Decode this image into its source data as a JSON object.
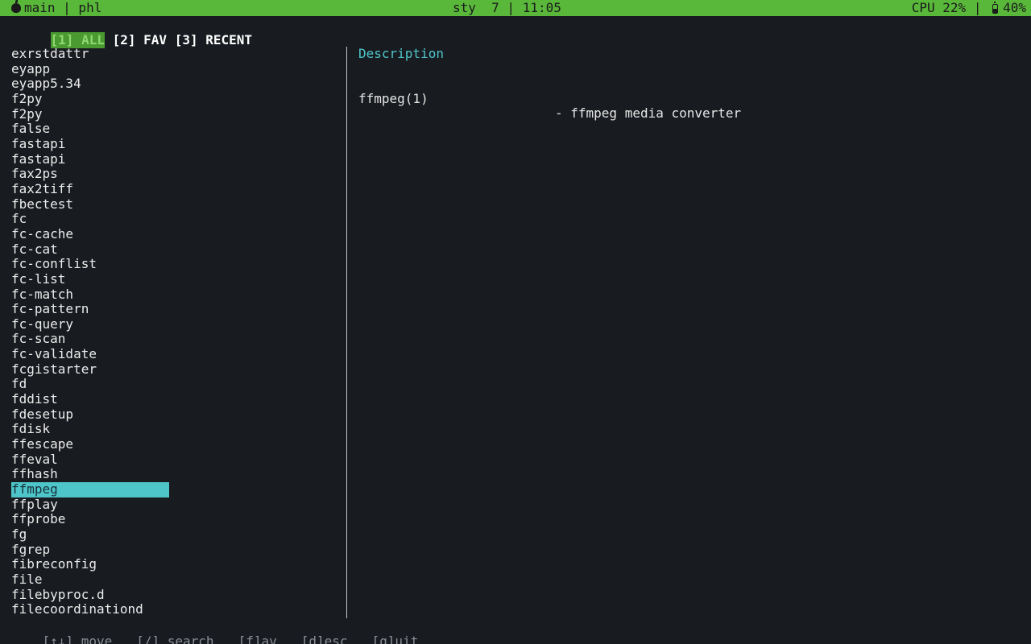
{
  "statusbar": {
    "left_text": "main | phl",
    "center_text": "sty  7 | 11:05",
    "cpu_text": "CPU 22% |",
    "battery_text": "40%",
    "bg_color": "#59b73a"
  },
  "tabs": [
    {
      "label": "[1] ALL",
      "active": true
    },
    {
      "label": "[2] FAV",
      "active": false
    },
    {
      "label": "[3] RECENT",
      "active": false
    }
  ],
  "commands": [
    "exrstdattr",
    "eyapp",
    "eyapp5.34",
    "f2py",
    "f2py",
    "false",
    "fastapi",
    "fastapi",
    "fax2ps",
    "fax2tiff",
    "fbectest",
    "fc",
    "fc-cache",
    "fc-cat",
    "fc-conflist",
    "fc-list",
    "fc-match",
    "fc-pattern",
    "fc-query",
    "fc-scan",
    "fc-validate",
    "fcgistarter",
    "fd",
    "fddist",
    "fdesetup",
    "fdisk",
    "ffescape",
    "ffeval",
    "ffhash",
    "ffmpeg",
    "ffplay",
    "ffprobe",
    "fg",
    "fgrep",
    "fibreconfig",
    "file",
    "filebyproc.d",
    "filecoordinationd"
  ],
  "selected_command": "ffmpeg",
  "description": {
    "heading": "Description",
    "name": "ffmpeg(1)",
    "text": "- ffmpeg media converter"
  },
  "footer": {
    "move": "[↑↓] move",
    "search": "[/] search",
    "fav": "[f]av",
    "desc": "[d]esc",
    "quit": "[q]uit"
  },
  "colors": {
    "accent": "#4ec6c9",
    "background": "#181b20",
    "status_green": "#59b73a"
  }
}
